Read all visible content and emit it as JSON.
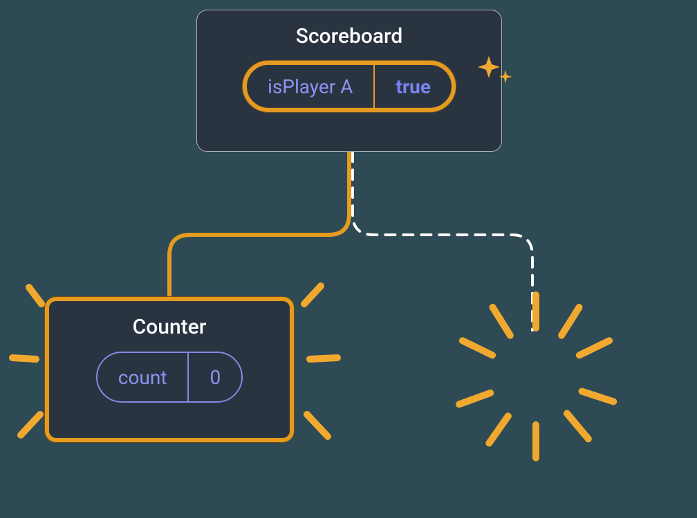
{
  "scoreboard": {
    "title": "Scoreboard",
    "state_key": "isPlayer A",
    "state_value": "true"
  },
  "counter": {
    "title": "Counter",
    "state_key": "count",
    "state_value": "0"
  },
  "colors": {
    "highlight": "#e49b1f",
    "node_bg": "#2a3441",
    "text_accent": "#8c94f2"
  }
}
